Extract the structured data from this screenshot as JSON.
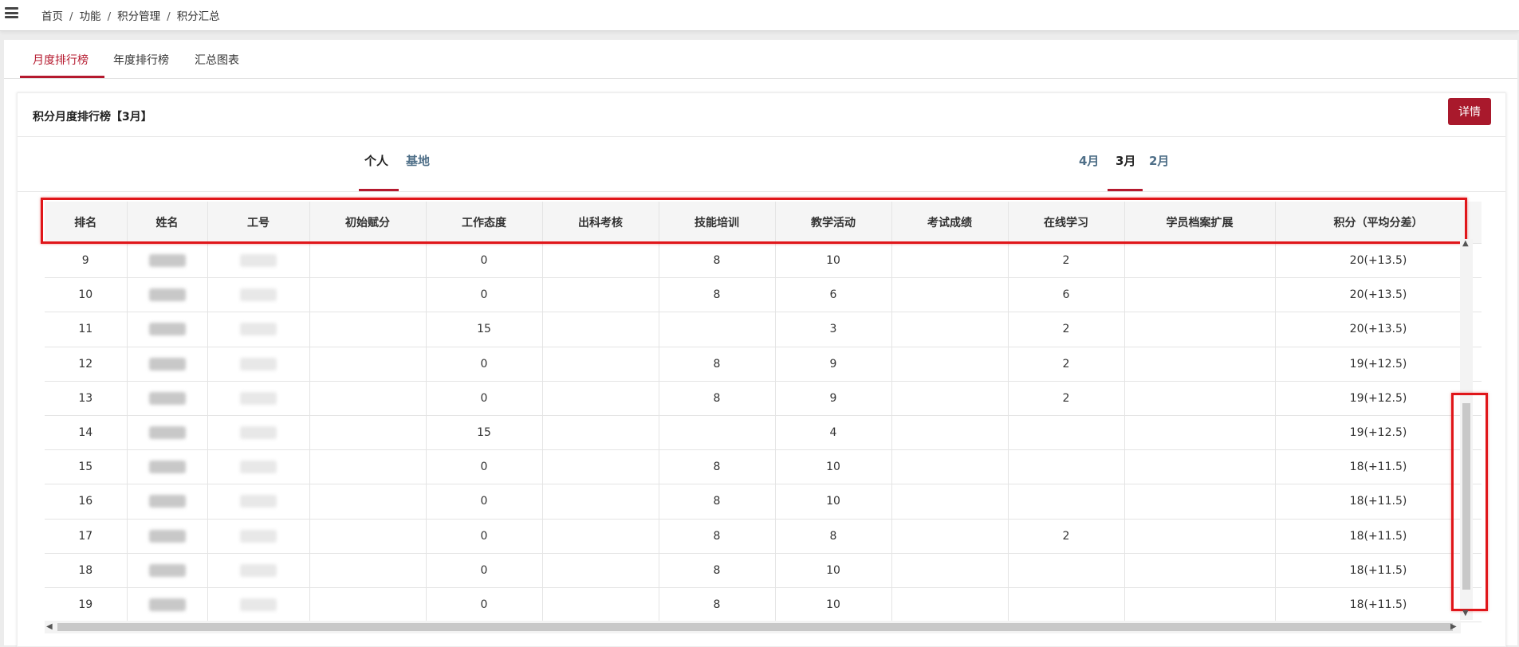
{
  "breadcrumb": [
    "首页",
    "功能",
    "积分管理",
    "积分汇总"
  ],
  "tabs": [
    "月度排行榜",
    "年度排行榜",
    "汇总图表"
  ],
  "card": {
    "title": "积分月度排行榜【3月】",
    "detail_button": "详情"
  },
  "scope_tabs": [
    "个人",
    "基地"
  ],
  "month_tabs": [
    "4月",
    "3月",
    "2月"
  ],
  "table": {
    "headers": [
      "排名",
      "姓名",
      "工号",
      "初始赋分",
      "工作态度",
      "出科考核",
      "技能培训",
      "教学活动",
      "考试成绩",
      "在线学习",
      "学员档案扩展",
      "积分（平均分差）"
    ],
    "rows": [
      [
        "9",
        "",
        "",
        "",
        "0",
        "",
        "8",
        "10",
        "",
        "2",
        "",
        "20(+13.5)"
      ],
      [
        "10",
        "",
        "",
        "",
        "0",
        "",
        "8",
        "6",
        "",
        "6",
        "",
        "20(+13.5)"
      ],
      [
        "11",
        "",
        "",
        "",
        "15",
        "",
        "",
        "3",
        "",
        "2",
        "",
        "20(+13.5)"
      ],
      [
        "12",
        "",
        "",
        "",
        "0",
        "",
        "8",
        "9",
        "",
        "2",
        "",
        "19(+12.5)"
      ],
      [
        "13",
        "",
        "",
        "",
        "0",
        "",
        "8",
        "9",
        "",
        "2",
        "",
        "19(+12.5)"
      ],
      [
        "14",
        "",
        "",
        "",
        "15",
        "",
        "",
        "4",
        "",
        "",
        "",
        "19(+12.5)"
      ],
      [
        "15",
        "",
        "",
        "",
        "0",
        "",
        "8",
        "10",
        "",
        "",
        "",
        "18(+11.5)"
      ],
      [
        "16",
        "",
        "",
        "",
        "0",
        "",
        "8",
        "10",
        "",
        "",
        "",
        "18(+11.5)"
      ],
      [
        "17",
        "",
        "",
        "",
        "0",
        "",
        "8",
        "8",
        "",
        "2",
        "",
        "18(+11.5)"
      ],
      [
        "18",
        "",
        "",
        "",
        "0",
        "",
        "8",
        "10",
        "",
        "",
        "",
        "18(+11.5)"
      ],
      [
        "19",
        "",
        "",
        "",
        "0",
        "",
        "8",
        "10",
        "",
        "",
        "",
        "18(+11.5)"
      ]
    ]
  },
  "colors": {
    "accent": "#b5192e",
    "highlight": "#e0161a"
  }
}
